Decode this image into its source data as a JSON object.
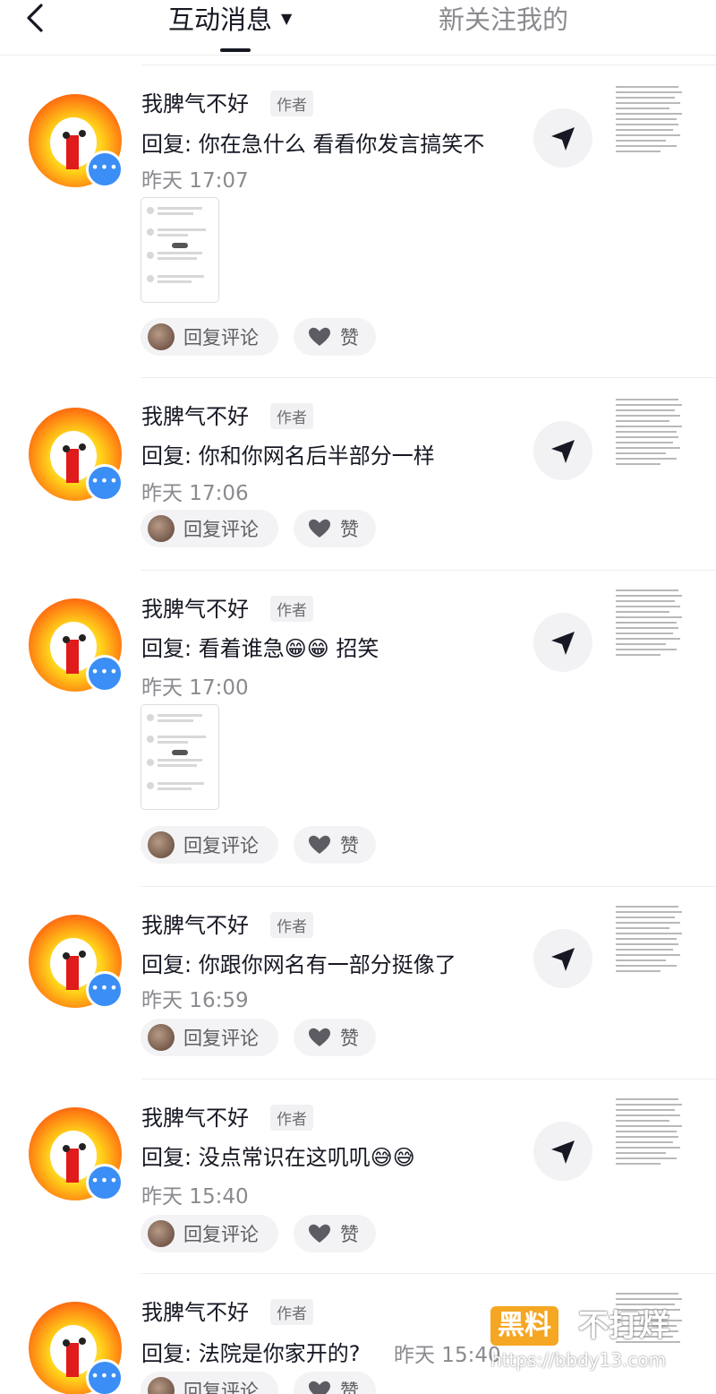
{
  "header": {
    "tab_active": "互动消息",
    "tab_inactive": "新关注我的"
  },
  "items": [
    {
      "username": "我脾气不好",
      "tag": "作者",
      "text": "回复: 你在急什么 看看你发言搞笑不",
      "time": "昨天 17:07",
      "reply_label": "回复评论",
      "like_label": "赞"
    },
    {
      "username": "我脾气不好",
      "tag": "作者",
      "text": "回复: 你和你网名后半部分一样",
      "time": "昨天 17:06",
      "reply_label": "回复评论",
      "like_label": "赞"
    },
    {
      "username": "我脾气不好",
      "tag": "作者",
      "text": "回复: 看着谁急😁😁 招笑",
      "time": "昨天 17:00",
      "reply_label": "回复评论",
      "like_label": "赞"
    },
    {
      "username": "我脾气不好",
      "tag": "作者",
      "text": "回复: 你跟你网名有一部分挺像了",
      "time": "昨天 16:59",
      "reply_label": "回复评论",
      "like_label": "赞"
    },
    {
      "username": "我脾气不好",
      "tag": "作者",
      "text": "回复: 没点常识在这叽叽😅😅",
      "time": "昨天 15:40",
      "reply_label": "回复评论",
      "like_label": "赞"
    },
    {
      "username": "我脾气不好",
      "tag": "作者",
      "text": "回复: 法院是你家开的?",
      "time": "昨天 15:40",
      "reply_label": "回复评论",
      "like_label": "赞"
    }
  ],
  "icons": {
    "back": "chevron-left-icon",
    "send": "send-arrow-icon",
    "like": "heart-icon",
    "badge": "comment-bubble-icon"
  },
  "colors": {
    "badge_blue": "#3a8ef5",
    "watermark_orange": "#f5a623"
  },
  "watermark": {
    "box": "黑料",
    "rest": "不打烊",
    "url": "https://bbdy13.com"
  }
}
